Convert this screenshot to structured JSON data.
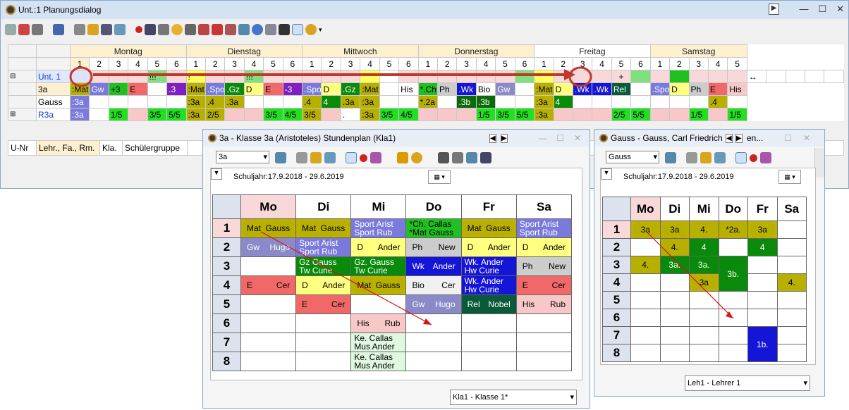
{
  "main": {
    "title": "Unt.:1  Planungsdialog"
  },
  "days": [
    "Montag",
    "Dienstag",
    "Mittwoch",
    "Donnerstag",
    "Freitag",
    "Samstag"
  ],
  "periods": [
    [
      "1",
      "2",
      "3",
      "4",
      "5",
      "6"
    ],
    [
      "1",
      "2",
      "3",
      "4",
      "5",
      "6"
    ],
    [
      "1",
      "2",
      "3",
      "4",
      "5",
      "6"
    ],
    [
      "1",
      "2",
      "3",
      "4",
      "5",
      "6"
    ],
    [
      "1",
      "2",
      "3",
      "4",
      "5",
      "6"
    ],
    [
      "1",
      "2",
      "3",
      "4",
      "5"
    ]
  ],
  "rows": [
    {
      "label": "Unt. 1",
      "cells": [
        "",
        "",
        "",
        "",
        "!!!",
        "",
        "!",
        "",
        "",
        "!!!",
        "",
        "",
        "",
        "",
        "",
        "",
        "",
        "",
        "",
        "",
        "",
        "",
        "",
        "",
        "",
        "",
        "",
        "",
        "+",
        "",
        "",
        "",
        "",
        "",
        "",
        "↔",
        "",
        "",
        "",
        ""
      ]
    },
    {
      "label": "3a",
      "cells": [
        ":Mat",
        "Gw",
        "+3",
        "E",
        "",
        ".3",
        ":Mat",
        ".Spo",
        ".Gz",
        "D",
        "E",
        "-3",
        ".Spo",
        "D",
        ".Gz",
        ":Mat",
        "",
        "His",
        "*.Ch",
        "Ph",
        ".Wk",
        "Bio",
        "Gw",
        "",
        ":Mat",
        "D",
        ".Wk",
        ".Wk",
        "Rel",
        "",
        ".Spo",
        "D",
        "Ph",
        "E",
        "His"
      ]
    },
    {
      "label": "Gauss",
      "cells": [
        ":3a",
        "",
        "",
        "",
        "",
        "",
        ":3a",
        ".4",
        ".3a",
        "",
        "",
        "",
        ".4",
        "4",
        ".3a",
        ":3a",
        "",
        "",
        "*.2a",
        "",
        ".3b",
        ".3b",
        "",
        "",
        ":3a",
        "4",
        "",
        "",
        "",
        "",
        "",
        "",
        "",
        ".4",
        ""
      ]
    },
    {
      "label": "R3a",
      "cells": [
        ":3a",
        "",
        "1/5",
        "",
        "3/5",
        "5/5",
        ":3a",
        "2/5",
        "",
        "",
        "3/5",
        "4/5",
        "3/5",
        "",
        ".",
        ":3a",
        "3/5",
        "4/5",
        "",
        "",
        "",
        "1/5",
        "3/5",
        "5/5",
        ":3a",
        "",
        "",
        "",
        "2/5",
        "5/5",
        "",
        "",
        "1/5",
        "",
        "1/5"
      ]
    }
  ],
  "bottom_headers": [
    "U-Nr",
    "Lehr., Fa., Rm.",
    "Kla.",
    "Schülergruppe"
  ],
  "class_window": {
    "title": "3a - Klasse 3a (Aristoteles)  Stundenplan  (Kla1)",
    "selector": "3a",
    "schuljahr": "Schuljahr:17.9.2018 - 29.6.2019",
    "days": [
      "Mo",
      "Di",
      "Mi",
      "Do",
      "Fr",
      "Sa"
    ],
    "periods": [
      "1",
      "2",
      "3",
      "4",
      "5",
      "6",
      "7",
      "8"
    ],
    "footer_select": "Kla1 - Klasse 1*"
  },
  "teacher_window": {
    "title": "Gauss - Gauss, Carl Friedrich",
    "title_extra": "en...",
    "selector": "Gauss",
    "schuljahr": "Schuljahr:17.9.2018 - 29.6.2019",
    "days": [
      "Mo",
      "Di",
      "Mi",
      "Do",
      "Fr",
      "Sa"
    ],
    "periods": [
      "1",
      "2",
      "3",
      "4",
      "5",
      "6",
      "7",
      "8"
    ],
    "footer_select": "Leh1 - Lehrer 1"
  },
  "class_cells": {
    "mo1": [
      "Mat",
      "Gauss"
    ],
    "di1": [
      "Mat",
      "Gauss"
    ],
    "mi1": [
      "Sport Arist",
      "Sport Rub"
    ],
    "do1": [
      "*Ch.   Callas",
      "*Mat   Gauss"
    ],
    "fr1": [
      "Mat",
      "Gauss"
    ],
    "sa1": [
      "Sport Arist",
      "Sport Rub"
    ],
    "mo2": [
      "Gw",
      "Hugo"
    ],
    "di2": [
      "Sport Arist",
      "Sport Rub"
    ],
    "mi2": [
      "D",
      "Ander"
    ],
    "do2": [
      "Ph",
      "New"
    ],
    "fr2": [
      "D",
      "Ander"
    ],
    "sa2": [
      "D",
      "Ander"
    ],
    "di3": [
      "Gz    Gauss",
      "Tw    Curie"
    ],
    "mi3": [
      "Gz.   Gauss",
      "Tw    Curie"
    ],
    "do3": [
      "Wk",
      "Ander"
    ],
    "fr3": [
      "Wk.   Ander",
      "Hw    Curie"
    ],
    "sa3": [
      "Ph",
      "New"
    ],
    "mo4": [
      "E",
      "Cer"
    ],
    "di4": [
      "D",
      "Ander"
    ],
    "mi4": [
      "Mat",
      "Gauss"
    ],
    "do4": [
      "Bio",
      "Cer"
    ],
    "fr4": [
      "Wk.   Ander",
      "Hw    Curie"
    ],
    "sa4": [
      "E",
      "Cer"
    ],
    "di5": [
      "E",
      "Cer"
    ],
    "do5": [
      "Gw",
      "Hugo"
    ],
    "fr5": [
      "Rel",
      "Nobel"
    ],
    "sa5": [
      "His",
      "Rub"
    ],
    "mi6": [
      "His",
      "Rub"
    ],
    "mi7": [
      "Ke.   Callas",
      "Mus   Ander"
    ],
    "mi8": [
      "Ke.   Callas",
      "Mus   Ander"
    ]
  },
  "teacher_cells": {
    "mo1": "3a",
    "di1": "3a",
    "mi1": "4.",
    "do1": "*2a.",
    "fr1": "3a",
    "di2": "4.",
    "mi2": "4",
    "fr2": "4",
    "mo3": "4.",
    "di3": "3a.",
    "mi3": "3a.",
    "do34": "3b.",
    "mi4": "3a",
    "sa4": "4.",
    "fr78": "1b."
  }
}
